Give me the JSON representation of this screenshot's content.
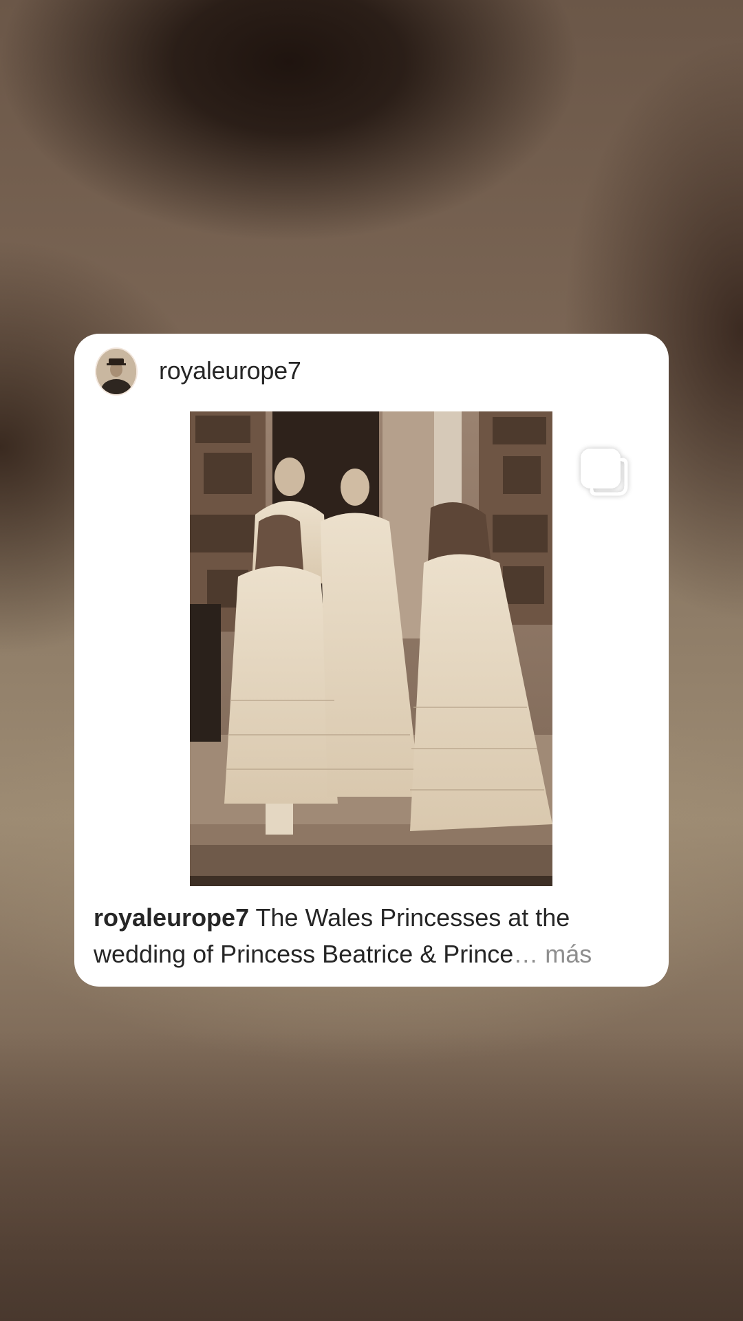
{
  "post": {
    "username": "royaleurope7",
    "caption_user": "royaleurope7",
    "caption_line1": " The Wales Princesses at the",
    "caption_line2": "wedding of Princess Beatrice & Prince",
    "ellipsis": "…",
    "more_label": " más"
  },
  "icons": {
    "multi_image": "carousel-icon",
    "avatar": "profile-avatar"
  },
  "colors": {
    "card_background": "#ffffff",
    "text_primary": "#262626",
    "text_secondary": "#8e8e8e",
    "photo_sepia": "#8a7563"
  }
}
